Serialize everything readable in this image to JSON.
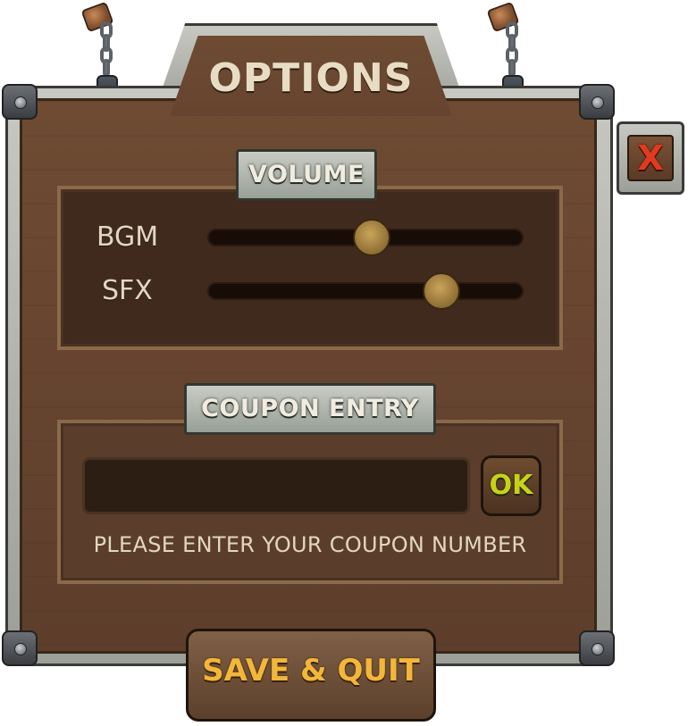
{
  "window": {
    "title": "OPTIONS"
  },
  "close_button": {
    "label": "X",
    "color": "#e23a1e"
  },
  "volume": {
    "section_label": "VOLUME",
    "sliders": [
      {
        "label": "BGM",
        "level": 0.52
      },
      {
        "label": "SFX",
        "level": 0.74
      }
    ]
  },
  "coupon": {
    "section_label": "COUPON ENTRY",
    "input_value": "",
    "ok_label": "OK",
    "hint": "PLEASE ENTER YOUR COUPON NUMBER"
  },
  "footer": {
    "save_quit_label": "SAVE & QUIT"
  },
  "colors": {
    "wood": "#664430",
    "frame_metal": "#9c9e98",
    "text_cream": "#e2d6c0",
    "ok_green": "#c6d21a",
    "save_orange": "#f2b63a"
  }
}
